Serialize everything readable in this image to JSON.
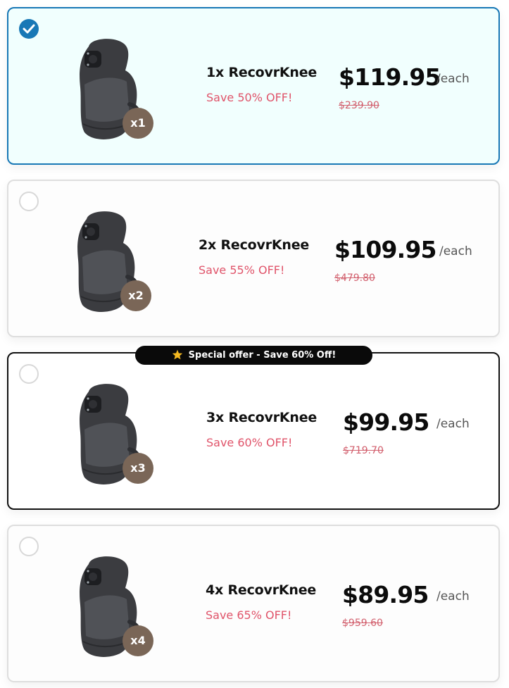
{
  "offer_ribbon": "Special offer - Save 60% Off!",
  "price_suffix": "/each",
  "colors": {
    "selected_border": "#1878b6",
    "selected_background": "#f1fffe",
    "save_text": "#e0546a",
    "badge": "#7a6657",
    "star": "#f5b921"
  },
  "options": [
    {
      "selected": true,
      "badge": "x1",
      "name": "1x RecovrKnee",
      "save": "Save 50% OFF!",
      "price": "$119.95",
      "old_price": "$239.90"
    },
    {
      "selected": false,
      "badge": "x2",
      "name": "2x RecovrKnee",
      "save": "Save 55% OFF!",
      "price": "$109.95",
      "old_price": "$479.80"
    },
    {
      "selected": false,
      "badge": "x3",
      "name": "3x RecovrKnee",
      "save": "Save 60% OFF!",
      "price": "$99.95",
      "old_price": "$719.70"
    },
    {
      "selected": false,
      "badge": "x4",
      "name": "4x RecovrKnee",
      "save": "Save 65% OFF!",
      "price": "$89.95",
      "old_price": "$959.60"
    }
  ]
}
